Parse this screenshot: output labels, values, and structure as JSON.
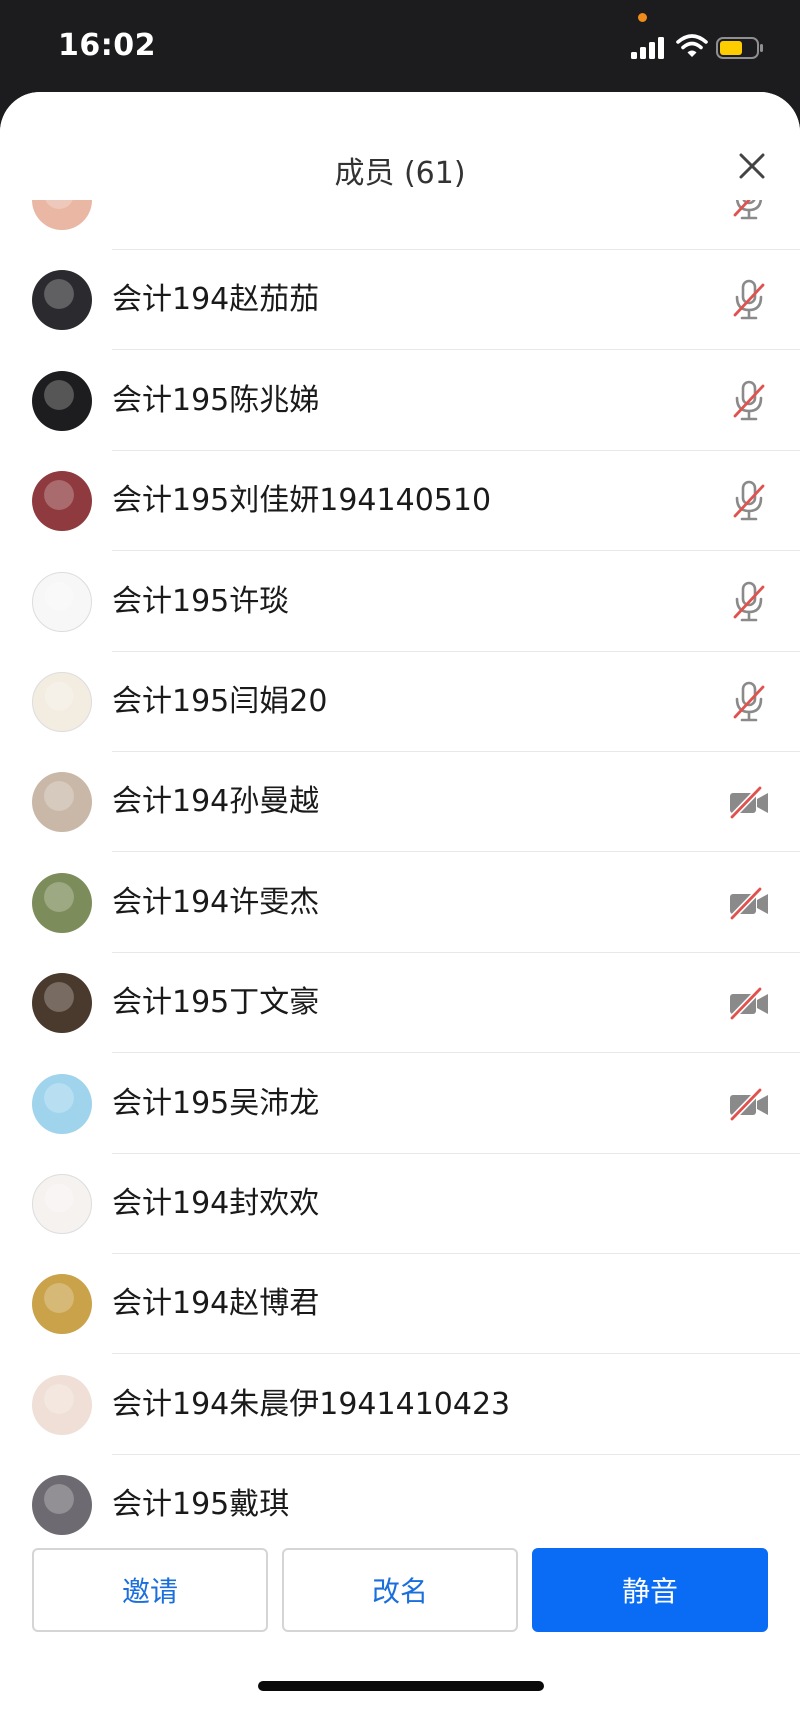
{
  "status_bar": {
    "time": "16:02"
  },
  "sheet": {
    "title": "成员 (61)"
  },
  "members": [
    {
      "name": "",
      "avatar_color": "#e9b7a4",
      "status_icon": "mic-muted-icon"
    },
    {
      "name": "会计194赵茄茄",
      "avatar_color": "#2b2a2e",
      "status_icon": "mic-muted-icon"
    },
    {
      "name": "会计195陈兆娣",
      "avatar_color": "#1d1d1f",
      "status_icon": "mic-muted-icon"
    },
    {
      "name": "会计195刘佳妍194140510",
      "avatar_color": "#8e3a3e",
      "status_icon": "mic-muted-icon"
    },
    {
      "name": "会计195许琰",
      "avatar_color": "#f7f7f7",
      "status_icon": "mic-muted-icon"
    },
    {
      "name": "会计195闫娟20",
      "avatar_color": "#f3ece0",
      "status_icon": "mic-muted-icon"
    },
    {
      "name": "会计194孙曼越",
      "avatar_color": "#c9b8a8",
      "status_icon": "camera-off-icon"
    },
    {
      "name": "会计194许雯杰",
      "avatar_color": "#7c8c5a",
      "status_icon": "camera-off-icon"
    },
    {
      "name": "会计195丁文豪",
      "avatar_color": "#4a3a2e",
      "status_icon": "camera-off-icon"
    },
    {
      "name": "会计195吴沛龙",
      "avatar_color": "#9fd4ec",
      "status_icon": "camera-off-icon"
    },
    {
      "name": "会计194封欢欢",
      "avatar_color": "#f5f2f0",
      "status_icon": ""
    },
    {
      "name": "会计194赵博君",
      "avatar_color": "#c9a24a",
      "status_icon": ""
    },
    {
      "name": "会计194朱晨伊1941410423",
      "avatar_color": "#efdfd6",
      "status_icon": ""
    },
    {
      "name": "会计195戴琪",
      "avatar_color": "#6e6a72",
      "status_icon": ""
    }
  ],
  "footer": {
    "invite_label": "邀请",
    "rename_label": "改名",
    "mute_label": "静音"
  },
  "colors": {
    "accent": "#0a6cf5",
    "muted_slash": "#e0524e",
    "icon_gray": "#8a8a8a"
  }
}
